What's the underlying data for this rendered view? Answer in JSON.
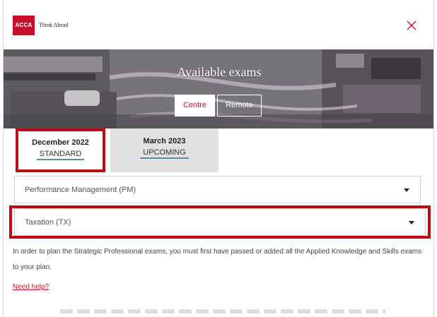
{
  "header": {
    "logo_text": "ACCA",
    "tagline": "Think Ahead"
  },
  "hero": {
    "title": "Available exams",
    "modes": [
      {
        "label": "Centre",
        "selected": true
      },
      {
        "label": "Remote",
        "selected": false
      }
    ]
  },
  "sessions": [
    {
      "title": "December 2022",
      "subtitle": "STANDARD",
      "selected": true
    },
    {
      "title": "March 2023",
      "subtitle": "UPCOMING",
      "selected": false
    }
  ],
  "exams": [
    {
      "label": "Performance Management (PM)"
    },
    {
      "label": "Taxation (TX)"
    }
  ],
  "info_text": "In order to plan the Strategic Professional exams, you must first have passed or added all the Applied Knowledge and Skills exams to your plan.",
  "help_link": "Need help?",
  "colors": {
    "brand_red": "#c8102e",
    "highlight_red": "#b80d12",
    "tab_underline": "#5a8fa8"
  }
}
